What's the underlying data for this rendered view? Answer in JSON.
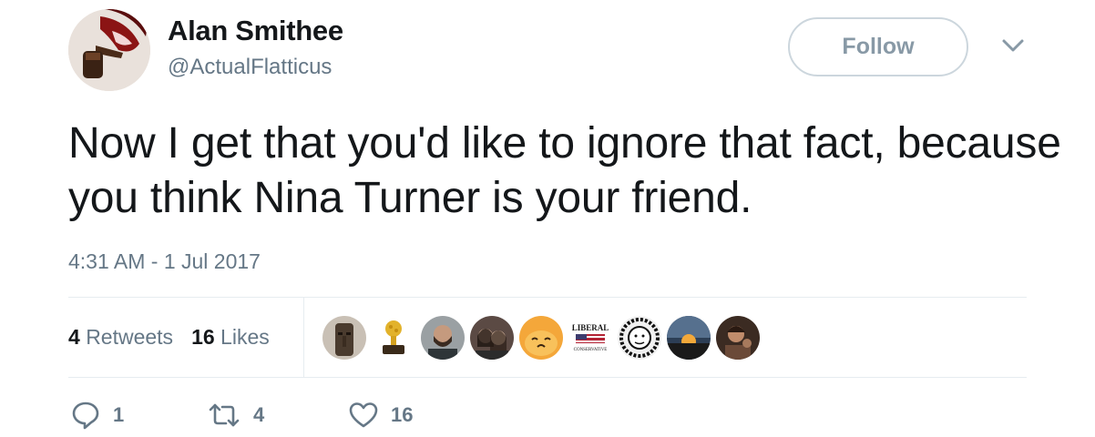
{
  "tweet": {
    "display_name": "Alan Smithee",
    "handle": "@ActualFlatticus",
    "follow_label": "Follow",
    "text": "Now I get that you'd like to ignore that fact, because you think Nina Turner is your friend.",
    "timestamp": "4:31 AM - 1 Jul 2017"
  },
  "stats": {
    "retweets_count": "4",
    "retweets_label": "Retweets",
    "likes_count": "16",
    "likes_label": "Likes"
  },
  "likers": [
    {
      "icon": "moai-statue-avatar"
    },
    {
      "icon": "raspberry-trophy-avatar"
    },
    {
      "icon": "bearded-man-avatar"
    },
    {
      "icon": "two-women-avatar"
    },
    {
      "icon": "cartoon-egg-avatar"
    },
    {
      "icon": "liberal-conservative-logo-avatar",
      "text_top": "LIBERAL",
      "text_bottom": "CONSERVATIVE"
    },
    {
      "icon": "sketch-portrait-avatar"
    },
    {
      "icon": "sunset-avatar"
    },
    {
      "icon": "person-photo-avatar"
    }
  ],
  "actions": {
    "reply_count": "1",
    "retweet_count": "4",
    "like_count": "16"
  },
  "colors": {
    "text_primary": "#14171a",
    "text_secondary": "#657786",
    "border": "#e6ecf0",
    "follow_border": "#ccd6dd"
  }
}
